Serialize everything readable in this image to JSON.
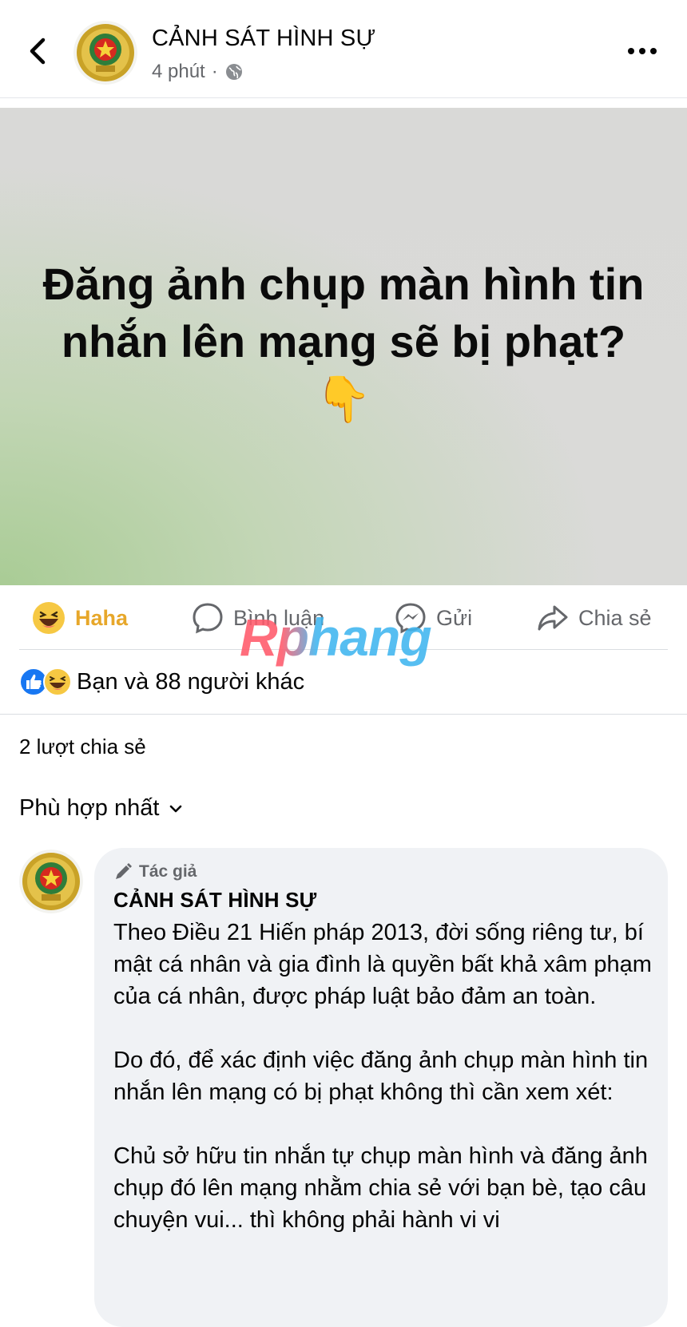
{
  "header": {
    "page_name": "CẢNH SÁT HÌNH SỰ",
    "time": "4 phút",
    "separator": "·"
  },
  "post": {
    "title": "Đăng ảnh chụp màn hình tin nhắn lên mạng sẽ bị phạt? 👇"
  },
  "actions": {
    "haha": "Haha",
    "comment": "Bình luận",
    "send": "Gửi",
    "share": "Chia sẻ"
  },
  "watermark": "Rphang",
  "reactions": {
    "summary": "Bạn và 88 người khác"
  },
  "shares": "2 lượt chia sẻ",
  "sort": "Phù hợp nhất",
  "comment": {
    "badge": "Tác giả",
    "author": "CẢNH SÁT HÌNH SỰ",
    "paragraphs": [
      "Theo Điều 21 Hiến pháp 2013, đời sống riêng tư, bí mật cá nhân và gia đình là quyền bất khả xâm phạm của cá nhân, được pháp luật bảo đảm an toàn.",
      "Do đó, để xác định việc đăng ảnh chụp màn hình tin nhắn lên mạng có bị phạt không thì cần xem xét:",
      "Chủ sở hữu tin nhắn tự chụp màn hình và đăng ảnh chụp đó lên mạng nhằm chia sẻ với bạn bè, tạo câu chuyện vui... thì không phải hành vi vi"
    ]
  },
  "colors": {
    "haha": "#e7a72a",
    "secondary_text": "#65676b",
    "bubble": "#f0f2f5",
    "like_blue": "#1877f2"
  },
  "icons": [
    "back-arrow-icon",
    "globe-icon",
    "more-icon",
    "haha-icon",
    "comment-icon",
    "messenger-icon",
    "share-icon",
    "like-icon",
    "chevron-down-icon",
    "pencil-icon"
  ]
}
